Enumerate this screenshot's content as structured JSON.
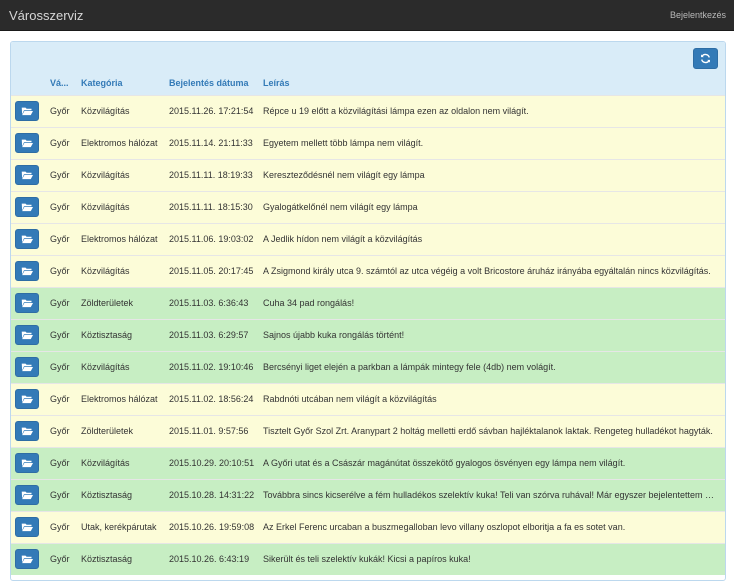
{
  "app": {
    "title": "Városszerviz",
    "login_label": "Bejelentkezés"
  },
  "colors": {
    "navbar": "#2b2b2b",
    "accent": "#337ab7",
    "header_bg": "#d9ecf8",
    "row_yellow": "#fcfcd8",
    "row_green": "#c7eec3"
  },
  "toolbar": {
    "refresh_icon": "refresh-icon"
  },
  "table": {
    "columns": [
      "Vá...",
      "Kategória",
      "Bejelentés dátuma",
      "Leírás"
    ],
    "row_icon": "folder-open-icon",
    "rows": [
      {
        "city": "Győr",
        "category": "Közvilágítás",
        "date": "2015.11.26. 17:21:54",
        "description": "Répce u 19 előtt a közvilágítási lámpa ezen az oldalon nem világít.",
        "status": "yellow"
      },
      {
        "city": "Győr",
        "category": "Elektromos hálózat",
        "date": "2015.11.14. 21:11:33",
        "description": "Egyetem mellett több lámpa nem világít.",
        "status": "yellow"
      },
      {
        "city": "Győr",
        "category": "Közvilágítás",
        "date": "2015.11.11. 18:19:33",
        "description": "Kereszteződésnél nem világít egy lámpa",
        "status": "yellow"
      },
      {
        "city": "Győr",
        "category": "Közvilágítás",
        "date": "2015.11.11. 18:15:30",
        "description": "Gyalogátkelőnél nem világít egy lámpa",
        "status": "yellow"
      },
      {
        "city": "Győr",
        "category": "Elektromos hálózat",
        "date": "2015.11.06. 19:03:02",
        "description": "A Jedlik hídon nem világít a közvilágítás",
        "status": "yellow"
      },
      {
        "city": "Győr",
        "category": "Közvilágítás",
        "date": "2015.11.05. 20:17:45",
        "description": "A Zsigmond király utca 9. számtól az utca végéig a volt Bricostore áruház irányába egyáltalán nincs közvilágítás.",
        "status": "yellow"
      },
      {
        "city": "Győr",
        "category": "Zöldterületek",
        "date": "2015.11.03. 6:36:43",
        "description": "Cuha 34 pad rongálás!",
        "status": "green"
      },
      {
        "city": "Győr",
        "category": "Köztisztaság",
        "date": "2015.11.03. 6:29:57",
        "description": "Sajnos újabb kuka rongálás történt!",
        "status": "green"
      },
      {
        "city": "Győr",
        "category": "Közvilágítás",
        "date": "2015.11.02. 19:10:46",
        "description": "Bercsényi liget elején a parkban a lámpák mintegy fele (4db) nem volágít.",
        "status": "green"
      },
      {
        "city": "Győr",
        "category": "Elektromos hálózat",
        "date": "2015.11.02. 18:56:24",
        "description": "Rabdnóti utcában nem világít a közvilágítás",
        "status": "yellow"
      },
      {
        "city": "Győr",
        "category": "Zöldterületek",
        "date": "2015.11.01. 9:57:56",
        "description": "Tisztelt Győr Szol Zrt. Aranypart 2 holtág melletti erdő sávban hajléktalanok laktak. Rengeteg hulladékot hagyták.",
        "status": "yellow"
      },
      {
        "city": "Győr",
        "category": "Közvilágítás",
        "date": "2015.10.29. 20:10:51",
        "description": "A Győri utat és a Császár magánútat összekötő gyalogos ösvényen egy lámpa nem világít.",
        "status": "green"
      },
      {
        "city": "Győr",
        "category": "Köztisztaság",
        "date": "2015.10.28. 14:31:22",
        "description": "Továbbra sincs kicserélve a fém hulladékos szelektív kuka! Teli van szórva ruhával! Már egyszer bejelentettem és semmi nem történt.",
        "status": "green"
      },
      {
        "city": "Győr",
        "category": "Utak, kerékpárutak",
        "date": "2015.10.26. 19:59:08",
        "description": "Az Erkel Ferenc urcaban a buszmegalloban levo villany oszlopot elboritja a fa es sotet van.",
        "status": "yellow"
      },
      {
        "city": "Győr",
        "category": "Köztisztaság",
        "date": "2015.10.26. 6:43:19",
        "description": "Sikerült és teli szelektív kukák! Kicsi a papíros kuka!",
        "status": "green"
      }
    ]
  }
}
